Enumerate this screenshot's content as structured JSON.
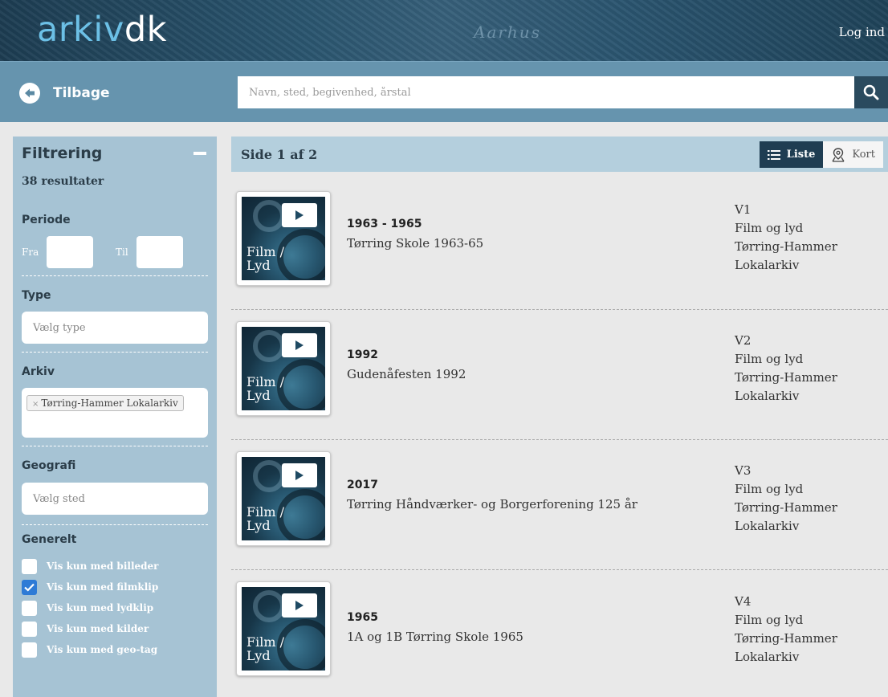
{
  "header": {
    "logo_part1": "arkiv",
    "logo_part2": "dk",
    "watermark": "Aarhus",
    "login": "Log ind"
  },
  "nav": {
    "back_label": "Tilbage",
    "search_placeholder": "Navn, sted, begivenhed, årstal"
  },
  "sidebar": {
    "title": "Filtrering",
    "result_count": "38 resultater",
    "period": {
      "title": "Periode",
      "from_label": "Fra",
      "to_label": "Til"
    },
    "type": {
      "title": "Type",
      "placeholder": "Vælg type"
    },
    "archive": {
      "title": "Arkiv",
      "tag": "Tørring-Hammer Lokalarkiv",
      "tag_remove": "×"
    },
    "geography": {
      "title": "Geografi",
      "placeholder": "Vælg sted"
    },
    "general": {
      "title": "Generelt",
      "options": [
        {
          "label": "Vis kun med billeder",
          "checked": false
        },
        {
          "label": "Vis kun med filmklip",
          "checked": true
        },
        {
          "label": "Vis kun med lydklip",
          "checked": false
        },
        {
          "label": "Vis kun med kilder",
          "checked": false
        },
        {
          "label": "Vis kun med geo-tag",
          "checked": false
        }
      ]
    }
  },
  "results": {
    "page_label": "Side 1 af 2",
    "view_list": "Liste",
    "view_map": "Kort",
    "items": [
      {
        "thumb_line1": "Film /",
        "thumb_line2": "Lyd",
        "date": "1963 - 1965",
        "title": "Tørring Skole 1963-65",
        "code": "V1",
        "type": "Film og lyd",
        "archive_line1": "Tørring-Hammer",
        "archive_line2": "Lokalarkiv"
      },
      {
        "thumb_line1": "Film /",
        "thumb_line2": "Lyd",
        "date": "1992",
        "title": "Gudenåfesten 1992",
        "code": "V2",
        "type": "Film og lyd",
        "archive_line1": "Tørring-Hammer",
        "archive_line2": "Lokalarkiv"
      },
      {
        "thumb_line1": "Film /",
        "thumb_line2": "Lyd",
        "date": "2017",
        "title": "Tørring Håndværker- og Borgerforening 125 år",
        "code": "V3",
        "type": "Film og lyd",
        "archive_line1": "Tørring-Hammer",
        "archive_line2": "Lokalarkiv"
      },
      {
        "thumb_line1": "Film /",
        "thumb_line2": "Lyd",
        "date": "1965",
        "title": "1A og 1B Tørring Skole 1965",
        "code": "V4",
        "type": "Film og lyd",
        "archive_line1": "Tørring-Hammer",
        "archive_line2": "Lokalarkiv"
      }
    ]
  }
}
